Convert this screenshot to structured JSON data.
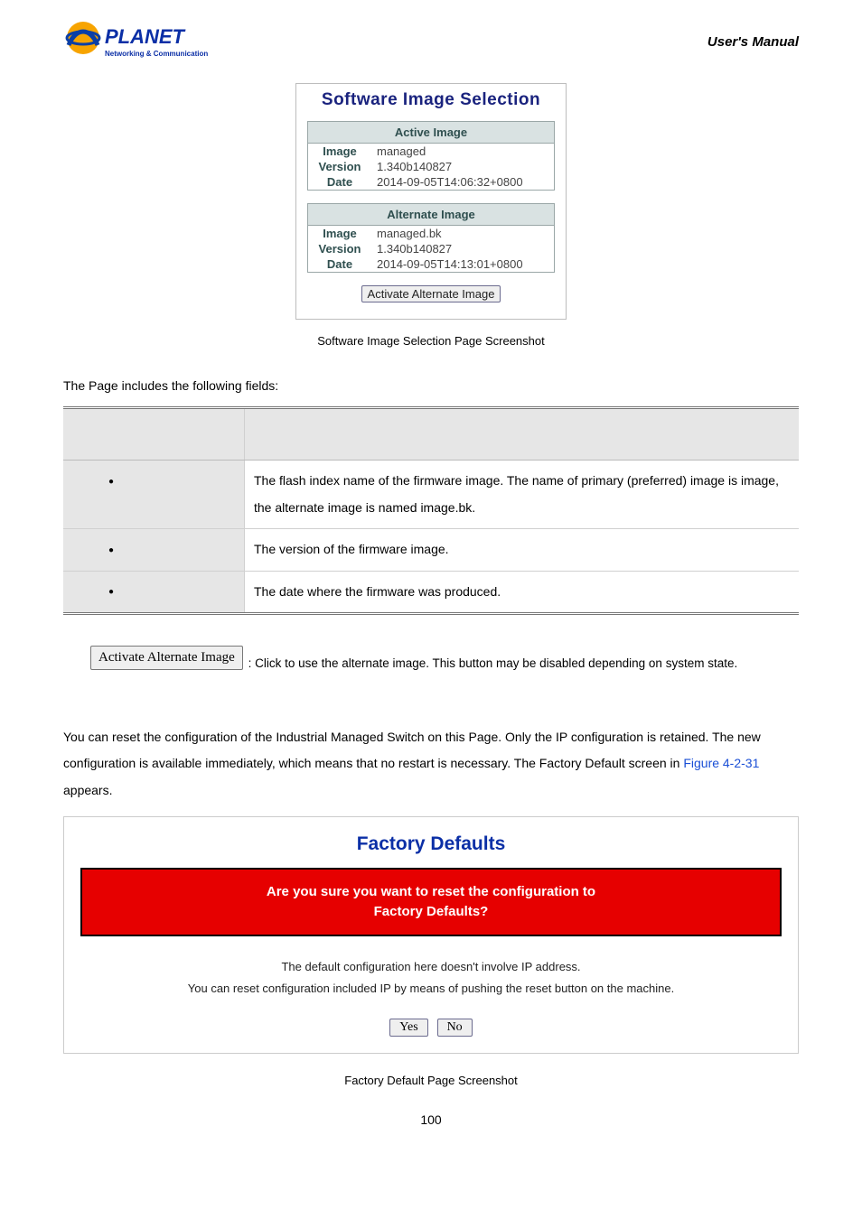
{
  "header": {
    "manual_label": "User's  Manual",
    "logo": {
      "brand": "PLANET",
      "tagline": "Networking & Communication"
    }
  },
  "sis": {
    "title": "Software Image Selection",
    "active": {
      "heading": "Active Image",
      "rows": {
        "image_k": "Image",
        "image_v": "managed",
        "version_k": "Version",
        "version_v": "1.340b140827",
        "date_k": "Date",
        "date_v": "2014-09-05T14:06:32+0800"
      }
    },
    "alternate": {
      "heading": "Alternate Image",
      "rows": {
        "image_k": "Image",
        "image_v": "managed.bk",
        "version_k": "Version",
        "version_v": "1.340b140827",
        "date_k": "Date",
        "date_v": "2014-09-05T14:13:01+0800"
      }
    },
    "activate_btn": "Activate Alternate Image",
    "caption": "Software Image Selection Page Screenshot"
  },
  "fields": {
    "intro": "The Page includes the following fields:",
    "rows": [
      {
        "desc": "The flash index name of the firmware image. The name of primary (preferred) image is image, the alternate image is named image.bk."
      },
      {
        "desc": "The version of the firmware image."
      },
      {
        "desc": "The date where the firmware was produced."
      }
    ]
  },
  "activate_note": {
    "btn": "Activate Alternate Image",
    "text": ": Click to use the alternate image. This button may be disabled depending on system state."
  },
  "factory": {
    "intro_a": "You can reset the configuration of the Industrial Managed Switch on this Page. Only the IP configuration is retained. The new configuration is available immediately, which means that no restart is necessary. The Factory Default screen in ",
    "intro_ref": "Figure 4-2-31",
    "intro_b": " appears.",
    "title": "Factory Defaults",
    "red_line1": "Are you sure you want to reset the configuration to",
    "red_line2": "Factory Defaults?",
    "note_line1": "The default configuration here doesn't involve IP address.",
    "note_line2": "You can reset configuration included IP by means of pushing the reset button on the machine.",
    "yes": "Yes",
    "no": "No",
    "caption": "Factory Default Page Screenshot"
  },
  "page_number": "100"
}
